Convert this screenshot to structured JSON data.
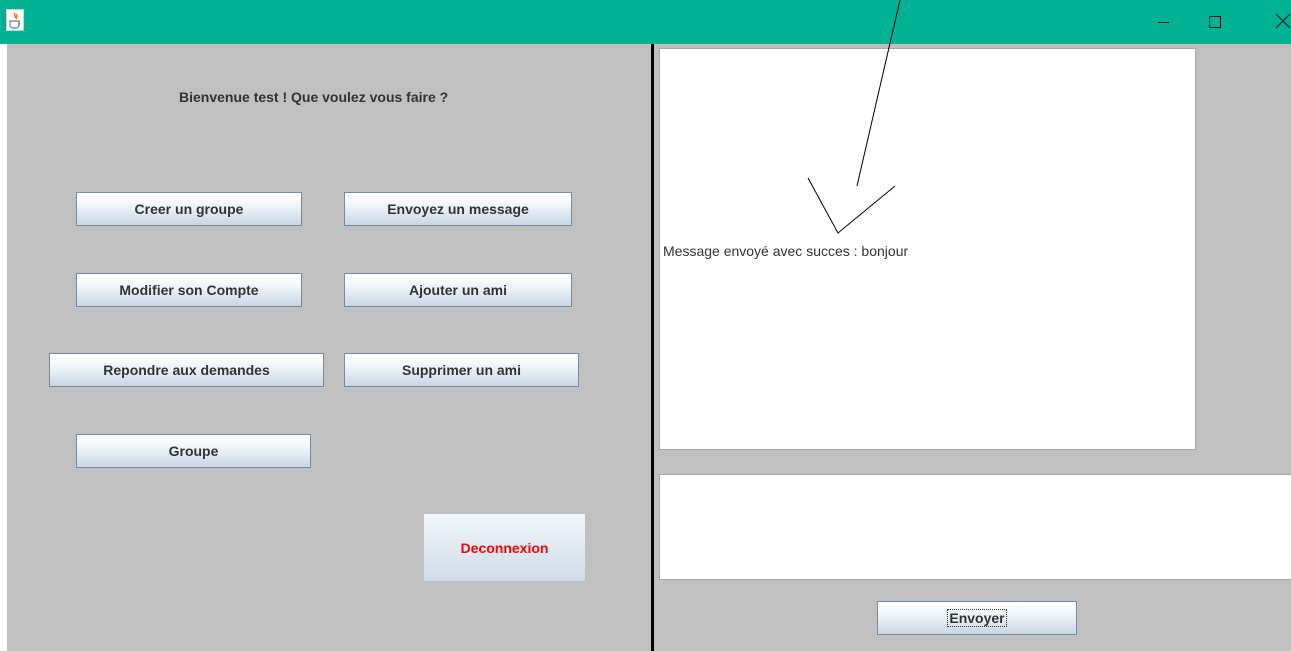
{
  "left": {
    "welcome": "Bienvenue test ! Que voulez vous faire ?",
    "buttons": {
      "create_group": "Creer un groupe",
      "send_message": "Envoyez un message",
      "edit_account": "Modifier son Compte",
      "add_friend": "Ajouter un ami",
      "answer_requests": "Repondre aux demandes",
      "remove_friend": "Supprimer un ami",
      "group": "Groupe",
      "logout": "Deconnexion"
    }
  },
  "right": {
    "chat_message": "Message envoyé avec succes : bonjour",
    "input_value": "",
    "send": "Envoyer"
  },
  "colors": {
    "titlebar": "#00b294",
    "panel": "#c0c0c0",
    "logout_text": "#ff0000"
  },
  "icons": {
    "app": "java-app-icon",
    "minimize": "minimize-icon",
    "maximize": "maximize-icon",
    "close": "close-icon"
  }
}
